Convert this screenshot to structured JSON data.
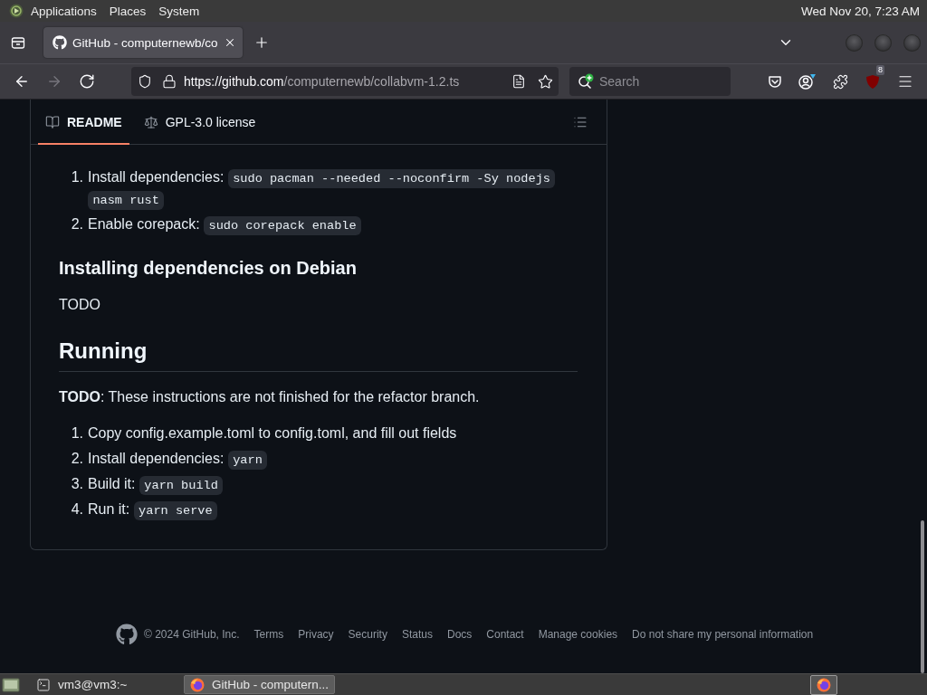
{
  "top_panel": {
    "menus": [
      "Applications",
      "Places",
      "System"
    ],
    "clock": "Wed Nov 20, 7:23 AM"
  },
  "browser": {
    "tabs": [
      {
        "title": "GitHub - computernewb/co",
        "selected": true
      }
    ],
    "nav_buttons": [
      {
        "kind": "back",
        "disabled": false
      },
      {
        "kind": "forward",
        "disabled": true
      },
      {
        "kind": "reload",
        "disabled": false
      }
    ],
    "address": {
      "domain": "https://github.com",
      "path": "/computernewb/collabvm-1.2.ts"
    },
    "search": {
      "placeholder": "Search"
    },
    "extension_badge": "8"
  },
  "readme": {
    "tabs": [
      {
        "kind": "book",
        "label": "README",
        "selected": true
      },
      {
        "kind": "scale",
        "label": "GPL-3.0 license",
        "selected": false
      }
    ],
    "blocks": [
      {
        "kind": "list",
        "items": [
          {
            "number": "1.",
            "text": "Install dependencies:",
            "code": [
              "sudo pacman --needed --noconfirm -Sy nodejs",
              "nasm rust"
            ]
          },
          {
            "number": "2.",
            "text": "Enable corepack:",
            "code": [
              "sudo corepack enable"
            ]
          }
        ]
      },
      {
        "kind": "h3",
        "text": "Installing dependencies on Debian"
      },
      {
        "kind": "p",
        "text": "TODO"
      },
      {
        "kind": "h2",
        "text": "Running"
      },
      {
        "kind": "p",
        "text": "**TODO**: These instructions are not finished for the refactor branch."
      },
      {
        "kind": "list",
        "items": [
          {
            "number": "1.",
            "text": "Copy config.example.toml to config.toml, and fill out fields"
          },
          {
            "number": "2.",
            "text": "Install dependencies:",
            "code": [
              "yarn"
            ]
          },
          {
            "number": "3.",
            "text": "Build it:",
            "code": [
              "yarn build"
            ]
          },
          {
            "number": "4.",
            "text": "Run it:",
            "code": [
              "yarn serve"
            ]
          }
        ]
      }
    ]
  },
  "footer": {
    "copyright": "© 2024 GitHub, Inc.",
    "links": [
      "Terms",
      "Privacy",
      "Security",
      "Status",
      "Docs",
      "Contact",
      "Manage cookies",
      "Do not share my personal information"
    ]
  },
  "taskbar": {
    "tasks": [
      {
        "kind": "terminal",
        "title": "vm3@vm3:~",
        "selected": false
      },
      {
        "kind": "browser",
        "title": "GitHub - computern...",
        "selected": true
      }
    ]
  }
}
